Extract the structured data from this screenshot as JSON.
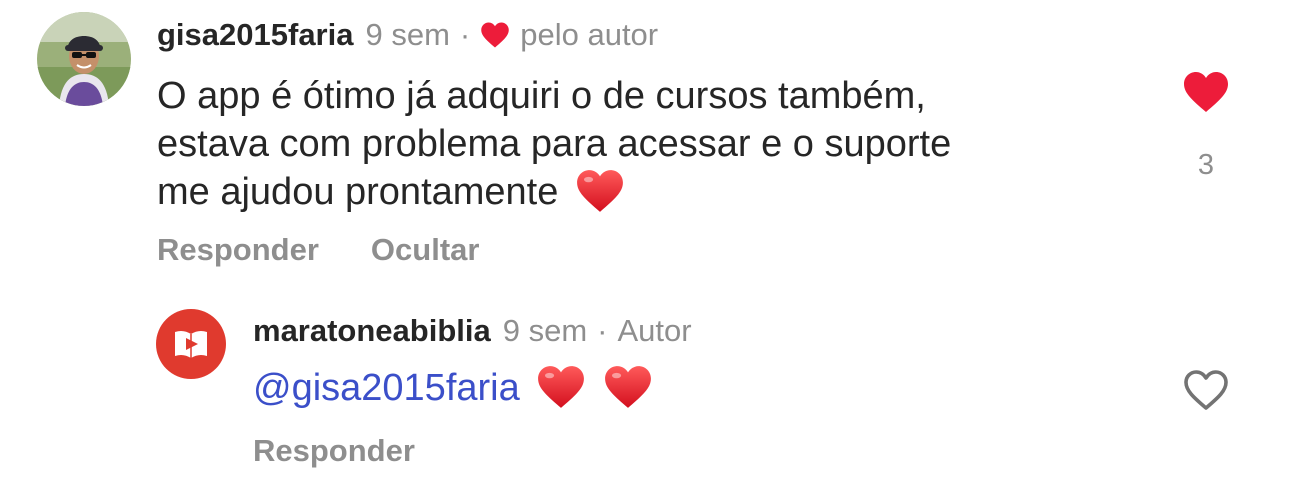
{
  "comment": {
    "username": "gisa2015faria",
    "time": "9 sem",
    "separator": "·",
    "liked_by_author_label": "pelo autor",
    "text_lines": [
      "O app é ótimo já adquiri o de cursos também,",
      "estava com problema para acessar e o suporte",
      "me ajudou prontamente"
    ],
    "emoji": "red-heart-emoji",
    "actions": {
      "reply_label": "Responder",
      "hide_label": "Ocultar"
    },
    "like": {
      "icon": "heart-filled-icon",
      "count": "3",
      "color": "#ed1c3a"
    }
  },
  "reply": {
    "username": "maratoneabiblia",
    "time": "9 sem",
    "separator": "·",
    "author_label": "Autor",
    "mention": "@gisa2015faria",
    "emojis": [
      "red-heart-emoji",
      "red-heart-emoji"
    ],
    "actions": {
      "reply_label": "Responder"
    },
    "like": {
      "icon": "heart-outline-icon"
    },
    "avatar_color": "#e03a2e"
  },
  "colors": {
    "text": "#262626",
    "muted": "#8e8e8e",
    "mention": "#3b4fc9",
    "heart": "#ed1c3a"
  }
}
